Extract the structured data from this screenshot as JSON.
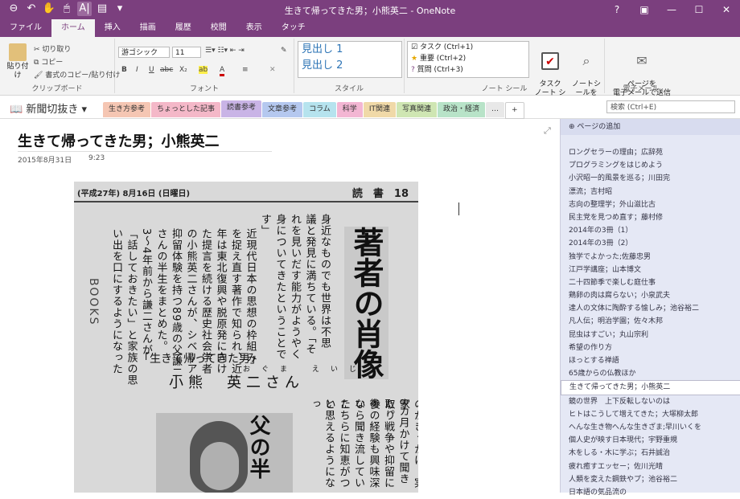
{
  "window": {
    "title": "生きて帰ってきた男；小熊英二 - OneNote",
    "help": "?",
    "controls": [
      "▣",
      "—",
      "☐",
      "✕"
    ]
  },
  "qat": [
    "⊖",
    "↶",
    "✋",
    "🖱",
    "A|",
    "▤",
    "▾"
  ],
  "ribbon_tabs": [
    "ファイル",
    "ホーム",
    "挿入",
    "描画",
    "履歴",
    "校閲",
    "表示",
    "タッチ"
  ],
  "ribbon": {
    "clipboard": {
      "paste": "貼り付け",
      "cut": "切り取り",
      "copy": "コピー",
      "format_painter": "書式のコピー/貼り付け",
      "label": "クリップボード"
    },
    "font": {
      "family": "游ゴシック",
      "size": "11",
      "bold": "B",
      "italic": "I",
      "underline": "U",
      "strike": "abc",
      "subscript": "X₂",
      "highlight": "ab",
      "font_color": "A",
      "align": "≡",
      "clear": "✕",
      "label": "フォント"
    },
    "styles": {
      "h1": "見出し 1",
      "h2": "見出し 2",
      "label": "スタイル"
    },
    "tags": {
      "items": [
        "タスク (Ctrl+1)",
        "重要 (Ctrl+2)",
        "質問 (Ctrl+3)"
      ],
      "todo_tag": "タスク\nノート シール",
      "find_tags": "ノートシールを\n検索",
      "label": "ノート シール"
    },
    "email": {
      "button": "ページを\n電子メールで送信",
      "label": "電子メール"
    }
  },
  "notebook": {
    "name": "新聞切抜き",
    "sections": [
      {
        "label": "生き方参考",
        "color": "#f5c6b3"
      },
      {
        "label": "ちょっとした記事",
        "color": "#f4b8c8"
      },
      {
        "label": "読書参考",
        "color": "#c9b4e6"
      },
      {
        "label": "文章参考",
        "color": "#b5c8ef"
      },
      {
        "label": "コラム",
        "color": "#b6e3ee"
      },
      {
        "label": "科学",
        "color": "#f3b6d3"
      },
      {
        "label": "IT関連",
        "color": "#f0d9a8"
      },
      {
        "label": "写真関連",
        "color": "#cfe6b3"
      },
      {
        "label": "政治・経済",
        "color": "#b8e3c8"
      },
      {
        "label": "…",
        "color": "#e8e8e8"
      },
      {
        "label": "+",
        "color": "#ffffff"
      }
    ],
    "active_section": "読書参考",
    "search_placeholder": "検索 (Ctrl+E)"
  },
  "page": {
    "title": "生きて帰ってきた男；小熊英二",
    "date": "2015年8月31日",
    "time": "9:23"
  },
  "clipping": {
    "header_left": "(平成27年) 8月16日 (日曜日)",
    "header_right": "読　書　18",
    "big_title": "著者の肖像",
    "books": "BOOKS",
    "columns": [
      "身近なものでも世界は不思",
      "議と発見に満ちている。「そ",
      "れを見いだす能力がようやく",
      "身についてきたということで",
      "す」",
      "近現代日本の思想の枠組み",
      "を捉え直す著作で知られ、近",
      "年は東北復興や脱原発に向け",
      "た提言を続ける歴史社会学者",
      "の小熊英二さんが、シベリア",
      "抑留体験を持つ89歳の父謙二",
      "さんの半生をまとめた。",
      "3〜4年前から謙二さんが",
      "「話しておきたい」と家族の思",
      "い出を口にするようになった"
    ],
    "quote": "「生きて帰ってきた男」",
    "ruby": "おぐま えいじ",
    "person": "小熊　英二さん",
    "right_cols": [
      "のがきっかけ。実家",
      "8カ月かけて聞き取り",
      "た。戦争や抑留に参",
      "後の経験も興味深い",
      "なら聞き流していた",
      "こちらに知恵がつい",
      "と思えるようになっ"
    ],
    "right_big": "父の半"
  },
  "sidebar": {
    "add_page": "ページの追加",
    "pages": [
      "ロングセラーの理由；広辞苑",
      "プログラミングをはじめよう",
      "小沢昭一的風景を巡る；川田完",
      "漂流；吉村昭",
      "志向の整理学；外山滋比古",
      "民主党を見つめ直す；藤村修",
      "2014年の3冊（1）",
      "2014年の3冊（2）",
      "独学でよかった;佐藤忠男",
      "江戸学講座；山本博文",
      "二十四節季で楽しむ庭仕事",
      "鶏卵の肉は腐らない；小泉武夫",
      "達人の文体に陶酔する愉しみ；池谷裕二",
      "凡人伝；明治学園；佐々木邦",
      "昆虫はすごい；丸山宗利",
      "希望の作り方",
      "ほっとする禅語",
      "65歳からの仏教ほか",
      "生きて帰ってきた男；小熊英二",
      "鏡の世界　上下反転しないのは",
      "ヒトはこうして増えてきた；大塚柳太郎",
      "へんな生き物へんな生きざま;早川いくを",
      "個人史が映す日本現代；宇野重規",
      "木をしる・木に学ぶ；石井誠治",
      "疲れ癒すエッセー；佐川光晴",
      "人類を変えた鋼鉄やプ；池谷裕二",
      "日本語の気品流の"
    ],
    "current_index": 18
  }
}
